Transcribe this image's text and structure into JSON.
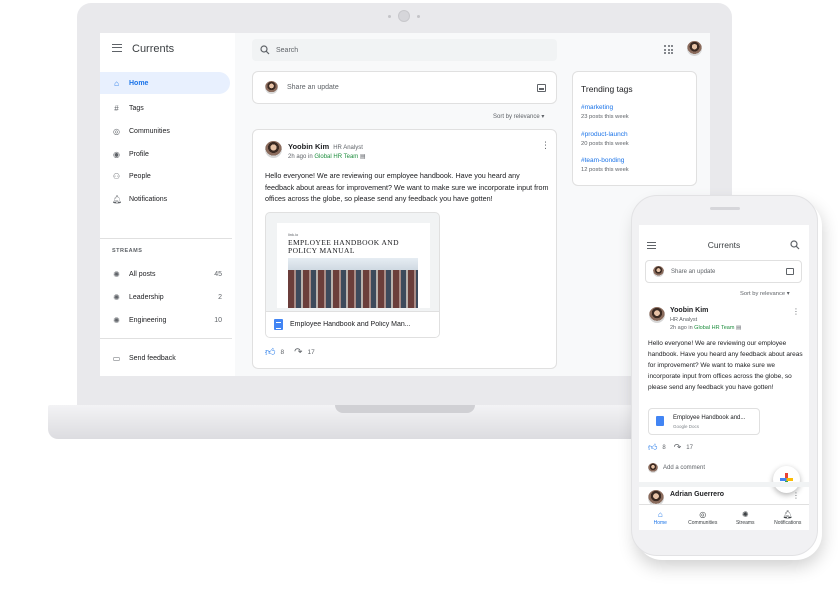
{
  "app": {
    "title": "Currents",
    "search_placeholder": "Search",
    "share_placeholder": "Share an update",
    "sort_label": "Sort by relevance ▾"
  },
  "sidebar": {
    "items": [
      {
        "label": "Home",
        "icon": "home-icon"
      },
      {
        "label": "Tags",
        "icon": "hash-icon"
      },
      {
        "label": "Communities",
        "icon": "communities-icon"
      },
      {
        "label": "Profile",
        "icon": "profile-icon"
      },
      {
        "label": "People",
        "icon": "people-icon"
      },
      {
        "label": "Notifications",
        "icon": "bell-icon"
      }
    ],
    "streams_label": "STREAMS",
    "streams": [
      {
        "label": "All posts",
        "count": "45"
      },
      {
        "label": "Leadership",
        "count": "2"
      },
      {
        "label": "Engineering",
        "count": "10"
      }
    ],
    "feedback_label": "Send feedback"
  },
  "post": {
    "author": "Yoobin Kim",
    "role": "HR Analyst",
    "time": "2h ago in",
    "team": "Global HR Team",
    "text": "Hello everyone! We are reviewing our employee handbook. Have you heard any feedback about areas for improvement? We want to make sure we incorporate input from offices across the globe, so please send any feedback you have gotten!",
    "doc_small": "link.io",
    "doc_title": "Employee Handbook and Policy Manual",
    "doc_name": "Employee Handbook and Policy Man...",
    "likes": "8",
    "shares": "17"
  },
  "trending": {
    "title": "Trending tags",
    "tags": [
      {
        "tag": "#marketing",
        "count": "23 posts this week"
      },
      {
        "tag": "#product-launch",
        "count": "20 posts this week"
      },
      {
        "tag": "#team-bonding",
        "count": "12 posts this week"
      }
    ]
  },
  "phone": {
    "title": "Currents",
    "share_placeholder": "Share an update",
    "sort_label": "Sort by relevance ▾",
    "author": "Yoobin Kim",
    "role": "HR Analyst",
    "time": "2h ago in",
    "team": "Global HR Team",
    "text": "Hello everyone! We are reviewing our employee handbook. Have you heard any feedback about areas for improvement? We want to make sure we incorporate input from offices across the globe, so please send any feedback you have gotten!",
    "doc_name": "Employee Handbook and...",
    "doc_sub": "Google Docs",
    "likes": "8",
    "shares": "17",
    "comment_placeholder": "Add a comment",
    "next_author": "Adrian Guerrero",
    "nav": [
      {
        "label": "Home",
        "icon": "home-icon"
      },
      {
        "label": "Communities",
        "icon": "communities-icon"
      },
      {
        "label": "Streams",
        "icon": "streams-icon"
      },
      {
        "label": "Notifications",
        "icon": "bell-icon"
      }
    ]
  },
  "colors": {
    "accent": "#1a73e8",
    "team_link": "#1e8e3e",
    "active_bg": "#e8f0fe"
  }
}
